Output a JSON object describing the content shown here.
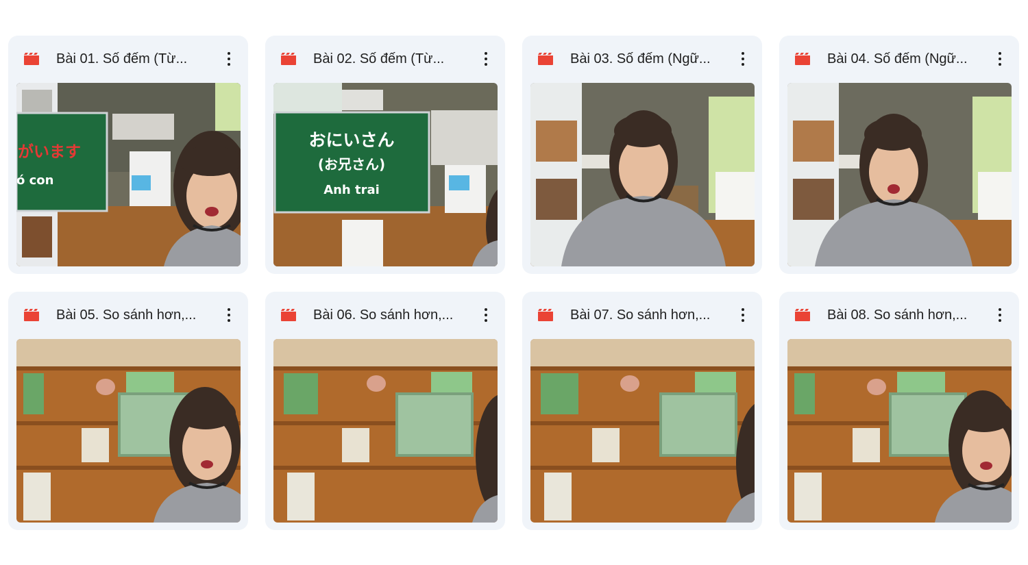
{
  "files": [
    {
      "title": "Bài 01. Số đếm (Từ...",
      "type_icon": "video-icon",
      "scene": "board-left",
      "board_line1": "がいます",
      "board_line2": "ó con"
    },
    {
      "title": "Bài 02. Số đếm (Từ...",
      "type_icon": "video-icon",
      "scene": "board-center",
      "board_line1": "おにいさん",
      "board_line2": "(お兄さん)",
      "board_line3": "Anh trai"
    },
    {
      "title": "Bài 03. Số đếm (Ngữ...",
      "type_icon": "video-icon",
      "scene": "room-center"
    },
    {
      "title": "Bài 04. Số đếm (Ngữ...",
      "type_icon": "video-icon",
      "scene": "room-center"
    },
    {
      "title": "Bài 05. So sánh hơn,...",
      "type_icon": "video-icon",
      "scene": "shelf-right"
    },
    {
      "title": "Bài 06. So sánh hơn,...",
      "type_icon": "video-icon",
      "scene": "shelf-edge"
    },
    {
      "title": "Bài 07. So sánh hơn,...",
      "type_icon": "video-icon",
      "scene": "shelf-edge"
    },
    {
      "title": "Bài 08. So sánh hơn,...",
      "type_icon": "video-icon",
      "scene": "shelf-right"
    }
  ],
  "colors": {
    "card_bg": "#f0f4f9",
    "video_icon": "#ea4335",
    "board_green": "#1e6b3d",
    "board_red_text": "#e53935"
  }
}
